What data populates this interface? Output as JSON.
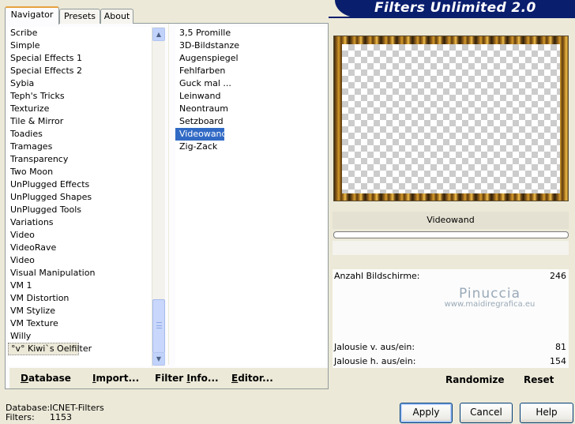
{
  "app": {
    "title": "Filters Unlimited 2.0"
  },
  "tabs": [
    {
      "label": "Navigator",
      "active": true
    },
    {
      "label": "Presets",
      "active": false
    },
    {
      "label": "About",
      "active": false
    }
  ],
  "categories": [
    "Scribe",
    "Simple",
    "Special Effects 1",
    "Special Effects 2",
    "Sybia",
    "Teph's Tricks",
    "Texturize",
    "Tile & Mirror",
    "Toadies",
    "Tramages",
    "Transparency",
    "Two Moon",
    "UnPlugged Effects",
    "UnPlugged Shapes",
    "UnPlugged Tools",
    "Variations",
    "Video",
    "VideoRave",
    "Video",
    "Visual Manipulation",
    "VM 1",
    "VM Distortion",
    "VM Stylize",
    "VM Texture",
    "Willy",
    "°v° Kiwi`s Oelfilter"
  ],
  "focused_category": "°v° Kiwi`s Oelfilter",
  "filters": [
    "3,5 Promille",
    "3D-Bildstanze",
    "Augenspiegel",
    "Fehlfarben",
    "Guck mal ...",
    "Leinwand",
    "Neontraum",
    "Setzboard",
    "Videowand",
    "Zig-Zack"
  ],
  "selected_filter": "Videowand",
  "link_buttons": {
    "database": {
      "first": "D",
      "rest": "atabase"
    },
    "import": {
      "first": "I",
      "rest": "mport..."
    },
    "filter_info": {
      "first": "Filter ",
      "u": "I",
      "rest": "nfo..."
    },
    "editor": {
      "first": "E",
      "rest": "ditor..."
    }
  },
  "settings_panel": {
    "filter_name": "Videowand",
    "progress_percent": 0,
    "params": [
      {
        "label": "Anzahl Bildschirme:",
        "value": "246"
      },
      {
        "label": "Jalousie v. aus/ein:",
        "value": "81"
      },
      {
        "label": "Jalousie h. aus/ein:",
        "value": "154"
      }
    ],
    "randomize_label": "Randomize",
    "reset_label": "Reset"
  },
  "watermark": {
    "line1": "Pinuccia",
    "line2": "www.maidiregrafica.eu"
  },
  "status": {
    "database_label": "Database:",
    "database_value": "ICNET-Filters",
    "filters_label": "Filters:",
    "filters_value": "1153"
  },
  "buttons": {
    "apply": "Apply",
    "cancel": "Cancel",
    "help": "Help"
  },
  "colors": {
    "banner": "#0A1E6E",
    "selection": "#316AC5",
    "tab_accent": "#E7A13E",
    "window_bg": "#ECE9D8"
  }
}
